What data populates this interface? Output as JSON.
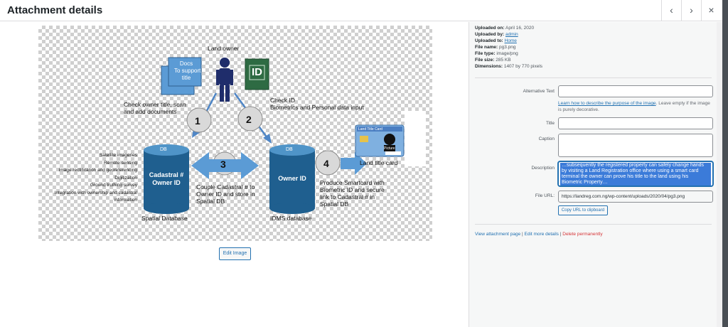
{
  "header": {
    "title": "Attachment details",
    "prev_glyph": "‹",
    "next_glyph": "›",
    "close_glyph": "×"
  },
  "image": {
    "land_owner": "Land owner",
    "docs_note": "Docs\nTo support\ntitle",
    "id_card": "ID",
    "step1": "1",
    "step2": "2",
    "step3": "3",
    "step4": "4",
    "check_owner": "Check owner title, scan\nand add documents",
    "check_id": "Check ID\nBiometrics and Personal data input",
    "land_title_card": "Land title card",
    "card_title": "Land Title Card",
    "card_picture": "Picture",
    "db_label": "DB",
    "cadastral_db": "Cadastral #\nOwner ID",
    "owner_db": "Owner ID",
    "left_list": "Satellite imageries\nRemote sensing\nImage rectification and georeferencing\nDigitization\nGround truthing survey\nIntegration with ownership and cadastral\ninformation",
    "couple": "Couple Cadastral # to\nOwner ID and store in\nSpatial DB",
    "produce": "Produce Smartcard with\nBiometric ID and secure\nlink to Cadastral # in\nSpatial DB",
    "spatial_db": "Spatial Database",
    "idms_db": "IDMS database"
  },
  "edit_image_label": "Edit Image",
  "meta": {
    "uploaded_on_label": "Uploaded on:",
    "uploaded_on": "April 16, 2020",
    "uploaded_by_label": "Uploaded by:",
    "uploaded_by": "admin",
    "uploaded_to_label": "Uploaded to:",
    "uploaded_to": "Home",
    "file_name_label": "File name:",
    "file_name": "pg3.png",
    "file_type_label": "File type:",
    "file_type": "image/png",
    "file_size_label": "File size:",
    "file_size": "285 KB",
    "dimensions_label": "Dimensions:",
    "dimensions": "1407 by 770 pixels"
  },
  "fields": {
    "alt_label": "Alternative Text",
    "alt_help_link": "Learn how to describe the purpose of the image",
    "alt_help_rest": ". Leave empty if the image is purely decorative.",
    "title_label": "Title",
    "caption_label": "Caption",
    "description_label": "Description",
    "description_value": "…subsequently the registered property can safely change hands by visiting a Land Registration office where using a smart card terminal the owner can prove his title to the land using his Biometric Property…",
    "file_url_label": "File URL:",
    "file_url_value": "https://landreg.com.ng/wp-content/uploads/2020/04/pg3.png",
    "copy_label": "Copy URL to clipboard"
  },
  "actions": {
    "view": "View attachment page",
    "edit": "Edit more details",
    "delete": "Delete permanently",
    "sep": " | "
  }
}
